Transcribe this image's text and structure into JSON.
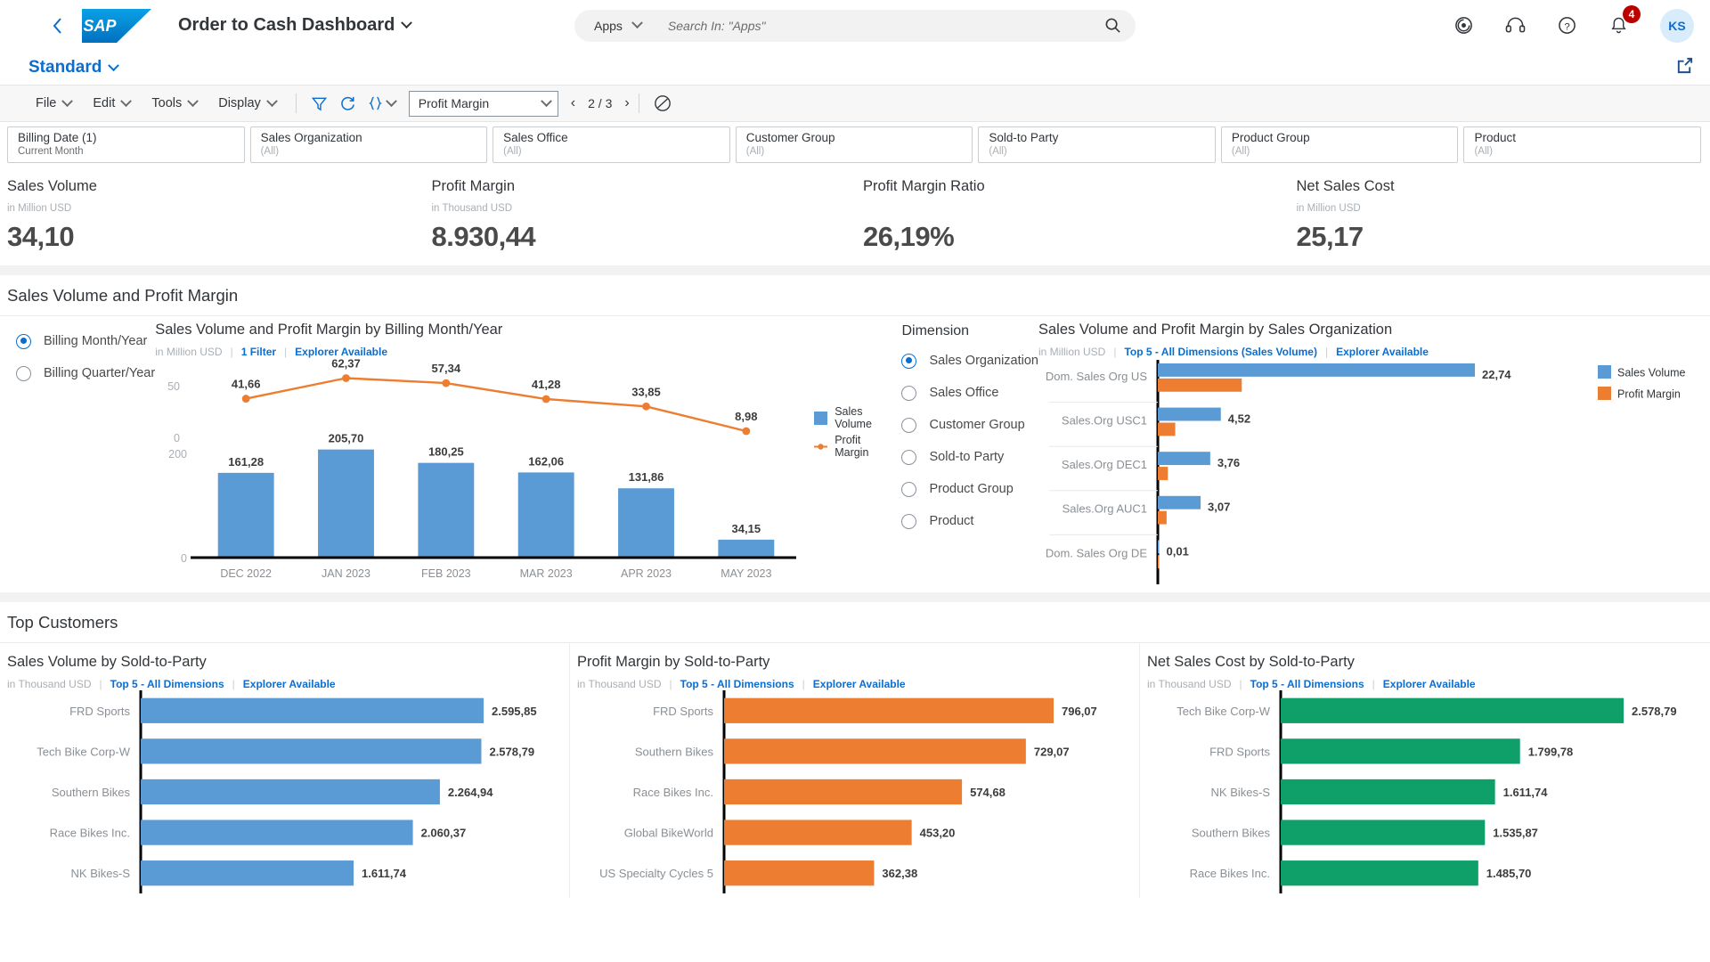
{
  "shell": {
    "back_icon": "chevron-left-icon",
    "logo_text": "SAP",
    "app_title": "Order to Cash Dashboard",
    "search": {
      "scope": "Apps",
      "placeholder": "Search In: \"Apps\""
    },
    "actions": {
      "target": "target-icon",
      "support": "headset-icon",
      "help": "question-mark-icon",
      "notifications": "bell-icon",
      "notification_count": "4",
      "avatar_initials": "KS"
    }
  },
  "variant": {
    "name": "Standard",
    "share_icon": "share-icon"
  },
  "toolbar": {
    "menus": [
      "File",
      "Edit",
      "Tools",
      "Display"
    ],
    "filter_icon": "filter-icon",
    "refresh_icon": "refresh-icon",
    "code_icon": "curly-braces-icon",
    "measure_selected": "Profit Margin",
    "page_current": "2 / 3",
    "prev_icon": "chevron-left-icon",
    "next_icon": "chevron-right-icon",
    "no_entry_icon": "circle-slash-icon"
  },
  "filters": [
    {
      "label": "Billing Date (1)",
      "value": "Current Month",
      "dim": false
    },
    {
      "label": "Sales Organization",
      "value": "(All)",
      "dim": true
    },
    {
      "label": "Sales Office",
      "value": "(All)",
      "dim": true
    },
    {
      "label": "Customer Group",
      "value": "(All)",
      "dim": true
    },
    {
      "label": "Sold-to Party",
      "value": "(All)",
      "dim": true
    },
    {
      "label": "Product Group",
      "value": "(All)",
      "dim": true
    },
    {
      "label": "Product",
      "value": "(All)",
      "dim": true
    }
  ],
  "kpis": [
    {
      "title": "Sales Volume",
      "unit": "in Million USD",
      "value": "34,10"
    },
    {
      "title": "Profit Margin",
      "unit": "in Thousand USD",
      "value": "8.930,44"
    },
    {
      "title": "Profit Margin Ratio",
      "unit": "",
      "value": "26,19%"
    },
    {
      "title": "Net Sales Cost",
      "unit": "in Million USD",
      "value": "25,17"
    }
  ],
  "section1": {
    "heading": "Sales Volume and Profit Margin",
    "granularity": {
      "options": [
        {
          "label": "Billing Month/Year",
          "selected": true
        },
        {
          "label": "Billing Quarter/Year",
          "selected": false
        }
      ]
    },
    "dimension": {
      "heading": "Dimension",
      "options": [
        {
          "label": "Sales Organization",
          "selected": true
        },
        {
          "label": "Sales Office",
          "selected": false
        },
        {
          "label": "Customer Group",
          "selected": false
        },
        {
          "label": "Sold-to Party",
          "selected": false
        },
        {
          "label": "Product Group",
          "selected": false
        },
        {
          "label": "Product",
          "selected": false
        }
      ]
    }
  },
  "section2": {
    "heading": "Top Customers"
  },
  "colors": {
    "sales_volume": "#5b9bd5",
    "profit_margin": "#ed7d31",
    "net_sales_cost": "#0fa06a",
    "link": "#0a6ed1",
    "axis": "#000000",
    "label": "#4a4a4a",
    "tick": "#a9afb5"
  },
  "chart_data": [
    {
      "id": "combo-by-month",
      "type": "bar",
      "title": "Sales Volume and Profit Margin by Billing Month/Year",
      "unit": "in Million USD",
      "links": [
        "1 Filter",
        "Explorer Available"
      ],
      "categories": [
        "DEC 2022",
        "JAN 2023",
        "FEB 2023",
        "MAR 2023",
        "APR 2023",
        "MAY 2023"
      ],
      "series": [
        {
          "name": "Sales Volume",
          "type": "bar",
          "values": [
            161.28,
            205.7,
            180.25,
            162.06,
            131.86,
            34.15
          ],
          "labels": [
            "161,28",
            "205,70",
            "180,25",
            "162,06",
            "131,86",
            "34,15"
          ],
          "ylim": [
            0,
            200
          ],
          "yticks": [
            "200",
            "0"
          ]
        },
        {
          "name": "Profit Margin",
          "type": "line",
          "values": [
            41.66,
            62.37,
            57.34,
            41.28,
            33.85,
            8.98
          ],
          "labels": [
            "41,66",
            "62,37",
            "57,34",
            "41,28",
            "33,85",
            "8,98"
          ],
          "ylim": [
            0,
            70
          ],
          "yticks": [
            "50",
            "0"
          ]
        }
      ],
      "legend": [
        "Sales Volume",
        "Profit Margin"
      ],
      "legend_position": "right",
      "grid": false
    },
    {
      "id": "by-sales-organization",
      "type": "bar",
      "title": "Sales Volume and Profit Margin by Sales Organization",
      "unit": "in Million USD",
      "links": [
        "Top 5 - All Dimensions (Sales Volume)",
        "Explorer Available"
      ],
      "orientation": "horizontal",
      "categories": [
        "Dom. Sales Org US",
        "Sales.Org USC1",
        "Sales.Org DEC1",
        "Sales.Org AUC1",
        "Dom. Sales Org DE"
      ],
      "series": [
        {
          "name": "Sales Volume",
          "values": [
            22.74,
            4.52,
            3.76,
            3.07,
            0.01
          ],
          "labels": [
            "22,74",
            "4,52",
            "3,76",
            "3,07",
            "0,01"
          ]
        },
        {
          "name": "Profit Margin",
          "values": [
            6.02,
            1.25,
            0.72,
            0.63,
            0.0
          ],
          "labels": []
        }
      ],
      "legend": [
        "Sales Volume",
        "Profit Margin"
      ],
      "legend_position": "right",
      "xlim": [
        0,
        22.74
      ]
    },
    {
      "id": "sales-volume-by-sold-to-party",
      "type": "bar",
      "orientation": "horizontal",
      "title": "Sales Volume by Sold-to-Party",
      "unit": "in Thousand USD",
      "links": [
        "Top 5 - All Dimensions",
        "Explorer Available"
      ],
      "categories": [
        "FRD Sports",
        "Tech Bike Corp-W",
        "Southern Bikes",
        "Race Bikes Inc.",
        "NK Bikes-S"
      ],
      "values": [
        2595.85,
        2578.79,
        2264.94,
        2060.37,
        1611.74
      ],
      "labels": [
        "2.595,85",
        "2.578,79",
        "2.264,94",
        "2.060,37",
        "1.611,74"
      ],
      "color": "#5b9bd5",
      "xlim": [
        0,
        2595.85
      ]
    },
    {
      "id": "profit-margin-by-sold-to-party",
      "type": "bar",
      "orientation": "horizontal",
      "title": "Profit Margin by Sold-to-Party",
      "unit": "in Thousand USD",
      "links": [
        "Top 5 - All Dimensions",
        "Explorer Available"
      ],
      "categories": [
        "FRD Sports",
        "Southern Bikes",
        "Race Bikes Inc.",
        "Global BikeWorld",
        "US Specialty Cycles 5"
      ],
      "values": [
        796.07,
        729.07,
        574.68,
        453.2,
        362.38
      ],
      "labels": [
        "796,07",
        "729,07",
        "574,68",
        "453,20",
        "362,38"
      ],
      "color": "#ed7d31",
      "xlim": [
        0,
        796.07
      ]
    },
    {
      "id": "net-sales-cost-by-sold-to-party",
      "type": "bar",
      "orientation": "horizontal",
      "title": "Net Sales Cost by Sold-to-Party",
      "unit": "in Thousand USD",
      "links": [
        "Top 5 - All Dimensions",
        "Explorer Available"
      ],
      "categories": [
        "Tech Bike Corp-W",
        "FRD Sports",
        "NK Bikes-S",
        "Southern Bikes",
        "Race Bikes Inc."
      ],
      "values": [
        2578.79,
        1799.78,
        1611.74,
        1535.87,
        1485.7
      ],
      "labels": [
        "2.578,79",
        "1.799,78",
        "1.611,74",
        "1.535,87",
        "1.485,70"
      ],
      "color": "#0fa06a",
      "xlim": [
        0,
        2578.79
      ]
    }
  ]
}
